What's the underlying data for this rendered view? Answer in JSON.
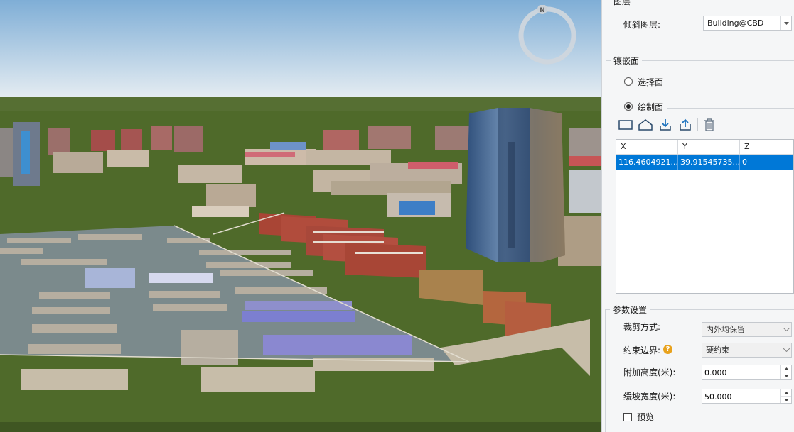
{
  "viewport": {
    "compass_letter": "N",
    "colors": {
      "sky_top": "#7faed6",
      "sky_bottom": "#e8eef3",
      "ground": "#4f6a2a",
      "parking": "#7b8a8c"
    }
  },
  "panel": {
    "layer_group_title": "图层",
    "oblique_layer_label": "倾斜图层:",
    "oblique_layer_value": "Building@CBD",
    "inlay_group_title": "镶嵌面",
    "select_face_label": "选择面",
    "draw_face_label": "绘制面",
    "toolbar_icons": [
      "rectangle-icon",
      "polygon-icon",
      "import-icon",
      "export-icon",
      "delete-icon"
    ],
    "grid": {
      "columns": [
        "X",
        "Y",
        "Z"
      ],
      "rows": [
        {
          "x": "116.4604921...",
          "y": "39.91545735...",
          "z": "0"
        }
      ]
    },
    "params_group_title": "参数设置",
    "clip_mode_label": "裁剪方式:",
    "clip_mode_value": "内外均保留",
    "constraint_label": "约束边界:",
    "constraint_value": "硬约束",
    "extra_height_label": "附加高度(米):",
    "extra_height_value": "0.000",
    "slope_width_label": "缓坡宽度(米):",
    "slope_width_value": "50.000",
    "preview_label": "预览",
    "accent": "#0078d7"
  }
}
